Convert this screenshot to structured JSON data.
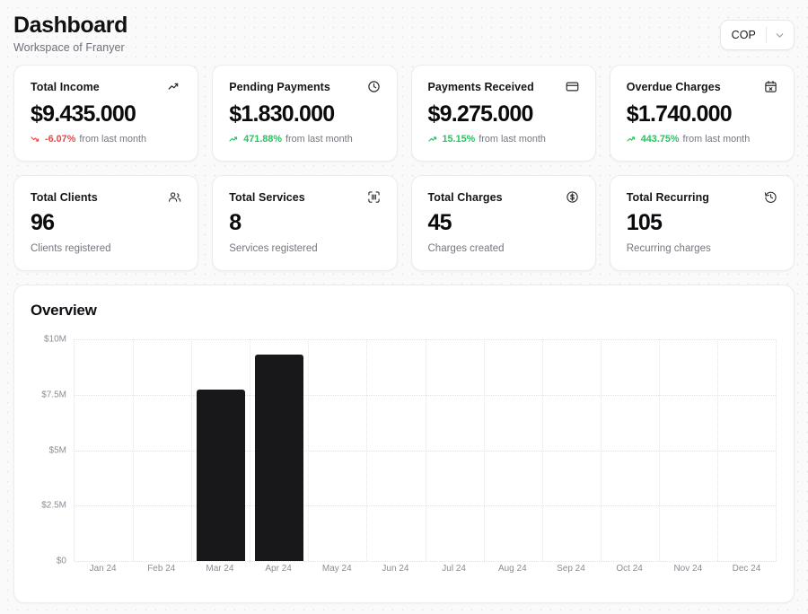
{
  "header": {
    "title": "Dashboard",
    "subtitle": "Workspace of Franyer",
    "currency": {
      "value": "COP",
      "chevron_icon": "chevron-down-icon"
    }
  },
  "stats_row1": [
    {
      "label": "Total Income",
      "value": "$9.435.000",
      "delta": "-6.07%",
      "delta_direction": "down",
      "delta_suffix": "from last month",
      "icon": "trending-up-icon"
    },
    {
      "label": "Pending Payments",
      "value": "$1.830.000",
      "delta": "471.88%",
      "delta_direction": "up",
      "delta_suffix": "from last month",
      "icon": "clock-icon"
    },
    {
      "label": "Payments Received",
      "value": "$9.275.000",
      "delta": "15.15%",
      "delta_direction": "up",
      "delta_suffix": "from last month",
      "icon": "credit-card-icon"
    },
    {
      "label": "Overdue Charges",
      "value": "$1.740.000",
      "delta": "443.75%",
      "delta_direction": "up",
      "delta_suffix": "from last month",
      "icon": "calendar-x-icon"
    }
  ],
  "stats_row2": [
    {
      "label": "Total Clients",
      "value": "96",
      "sub": "Clients registered",
      "icon": "users-icon"
    },
    {
      "label": "Total Services",
      "value": "8",
      "sub": "Services registered",
      "icon": "scan-icon"
    },
    {
      "label": "Total Charges",
      "value": "45",
      "sub": "Charges created",
      "icon": "dollar-circle-icon"
    },
    {
      "label": "Total Recurring",
      "value": "105",
      "sub": "Recurring charges",
      "icon": "history-icon"
    }
  ],
  "overview": {
    "title": "Overview"
  },
  "colors": {
    "bar": "#18181b",
    "positive": "#22c55e",
    "negative": "#ef4444",
    "grid": "#e4e4e8"
  },
  "chart_data": {
    "type": "bar",
    "title": "Overview",
    "xlabel": "",
    "ylabel": "",
    "categories": [
      "Jan 24",
      "Feb 24",
      "Mar 24",
      "Apr 24",
      "May 24",
      "Jun 24",
      "Jul 24",
      "Aug 24",
      "Sep 24",
      "Oct 24",
      "Nov 24",
      "Dec 24"
    ],
    "values": [
      0,
      0,
      7750000,
      9300000,
      0,
      0,
      0,
      0,
      0,
      0,
      0,
      0
    ],
    "ylim": [
      0,
      10000000
    ],
    "yticks": [
      0,
      2500000,
      5000000,
      7500000,
      10000000
    ],
    "ytick_labels": [
      "$0",
      "$2.5M",
      "$5M",
      "$7.5M",
      "$10M"
    ],
    "grid": true,
    "legend": false
  }
}
